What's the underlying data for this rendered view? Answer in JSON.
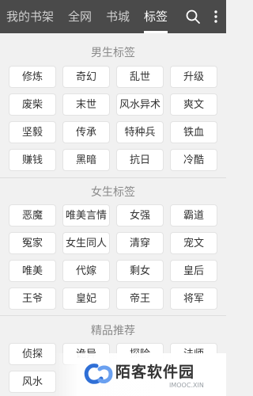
{
  "topbar": {
    "tabs": [
      {
        "label": "我的书架",
        "active": false
      },
      {
        "label": "全网",
        "active": false
      },
      {
        "label": "书城",
        "active": false
      },
      {
        "label": "标签",
        "active": true
      }
    ],
    "icons": [
      "search-icon",
      "more-vertical-icon"
    ]
  },
  "sections": [
    {
      "title": "男生标签",
      "tags": [
        "修炼",
        "奇幻",
        "乱世",
        "升级",
        "废柴",
        "末世",
        "风水异术",
        "爽文",
        "坚毅",
        "传承",
        "特种兵",
        "铁血",
        "赚钱",
        "黑暗",
        "抗日",
        "冷酷"
      ]
    },
    {
      "title": "女生标签",
      "tags": [
        "恶魔",
        "唯美言情",
        "女强",
        "霸道",
        "冤家",
        "女生同人",
        "清穿",
        "宠文",
        "唯美",
        "代嫁",
        "剩女",
        "皇后",
        "王爷",
        "皇妃",
        "帝王",
        "将军"
      ]
    },
    {
      "title": "精品推荐",
      "tags": [
        "侦探",
        "诡异",
        "探险",
        "法师",
        "风水"
      ]
    }
  ],
  "watermark": {
    "title": "陌客软件园",
    "subtitle": "IMOOC.XIN"
  },
  "colors": {
    "topbar_bg": "#4a4a4a",
    "page_bg": "#f1f1f1",
    "tag_bg": "#ffffff",
    "tag_border": "#e3e3e3",
    "watermark_blue": "#2f6fd6"
  }
}
